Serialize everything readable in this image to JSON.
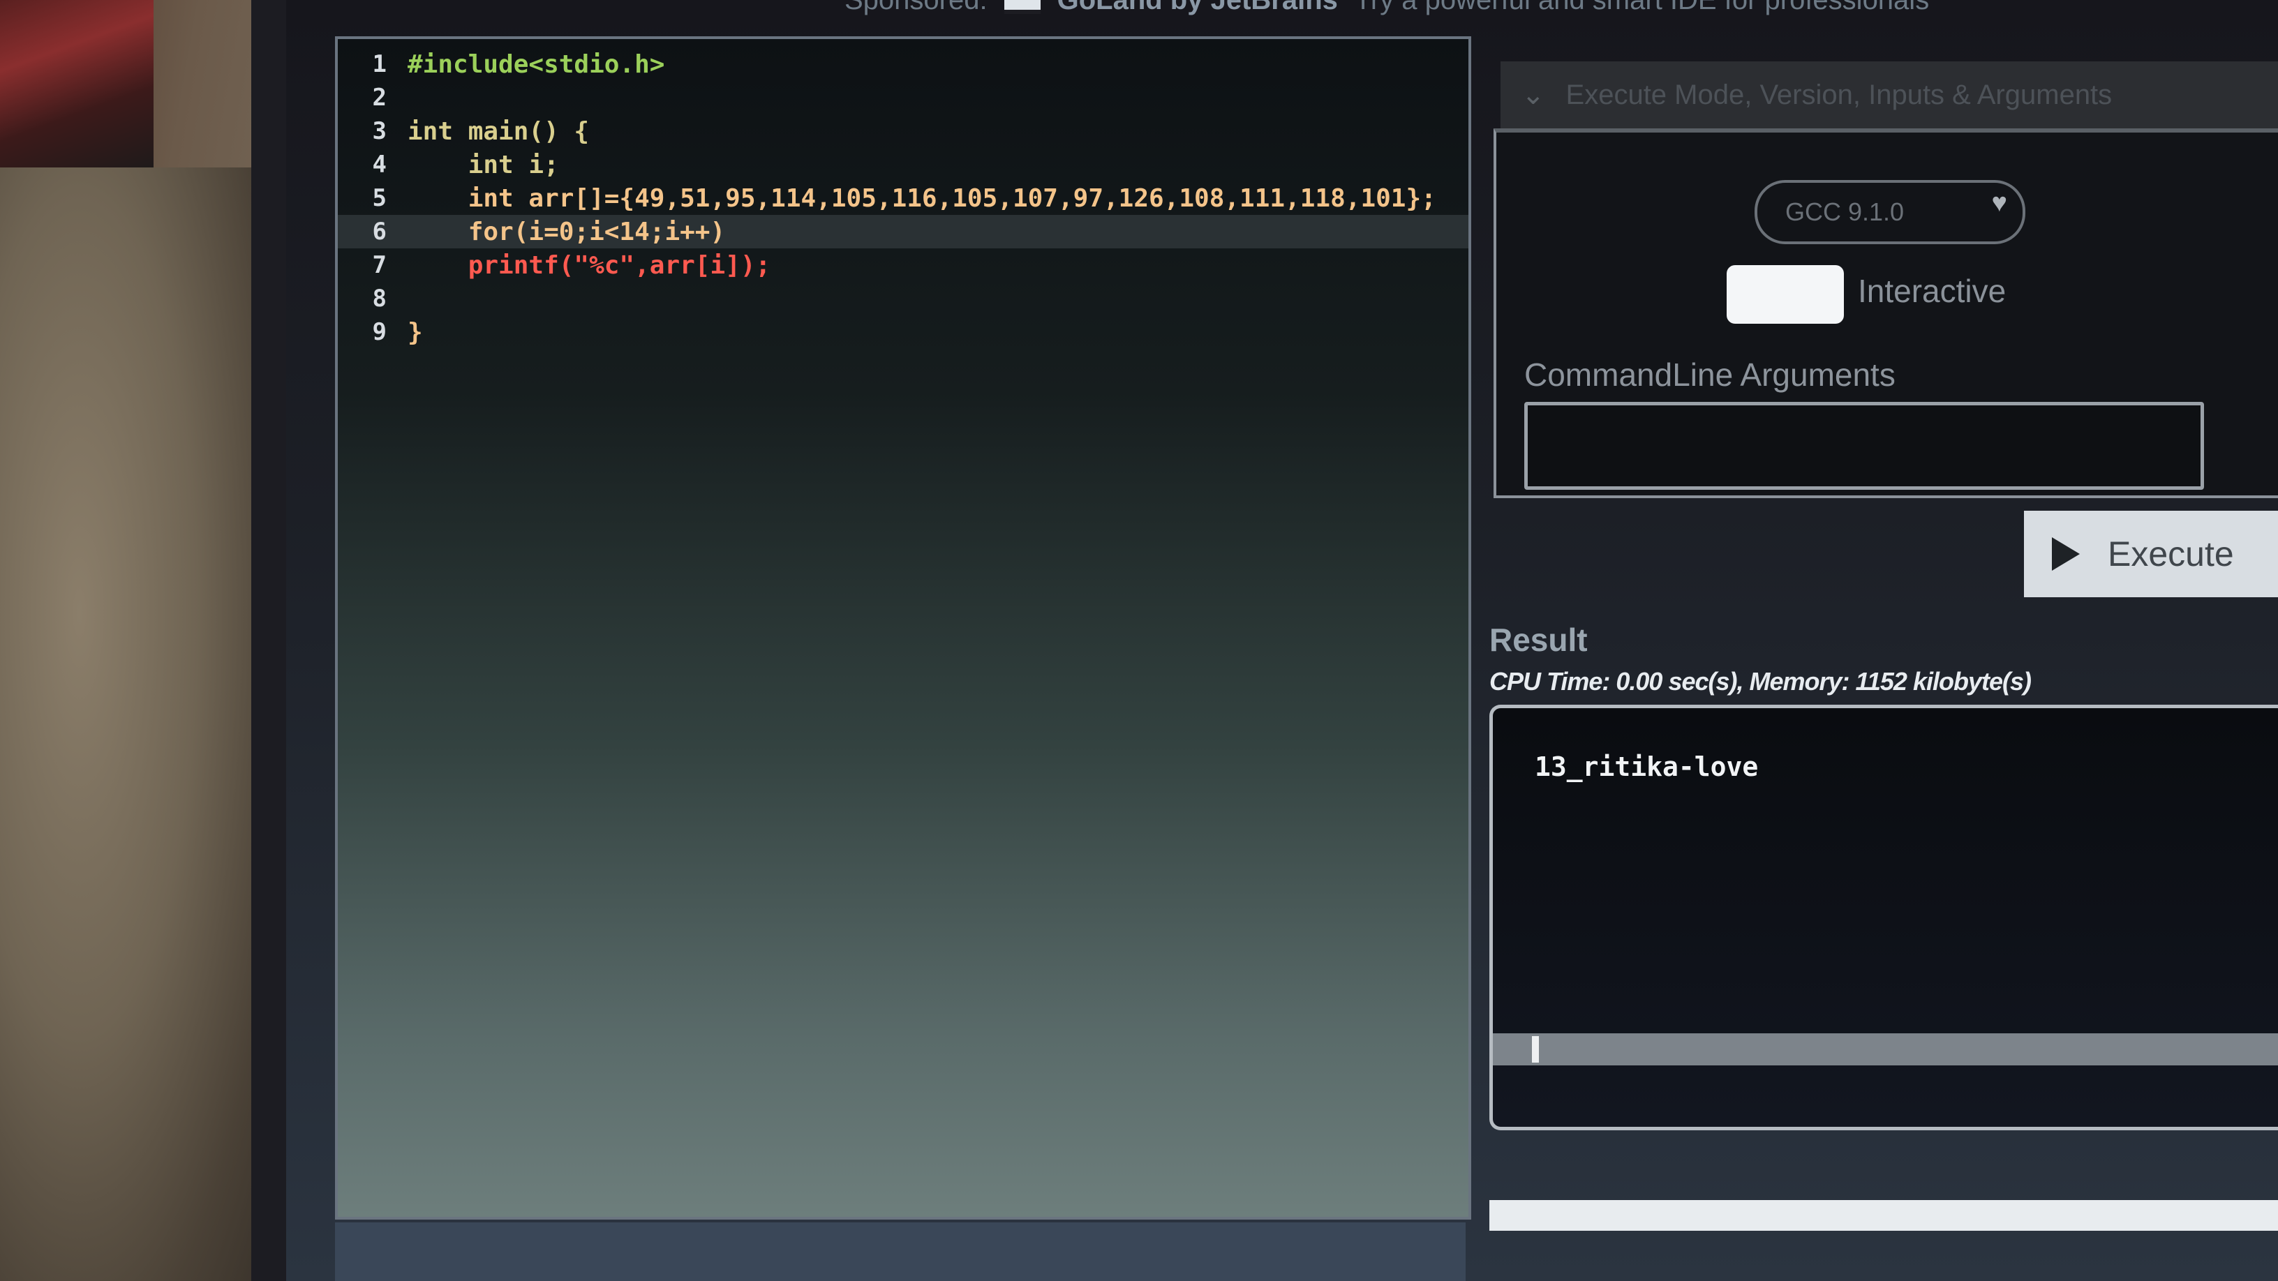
{
  "sponsor": {
    "label": "Sponsored:",
    "brand": "GoLand by JetBrains",
    "tagline": "Try a powerful and smart IDE for professionals"
  },
  "editor": {
    "lines": [
      {
        "num": "1",
        "text": "#include<stdio.h>"
      },
      {
        "num": "2",
        "text": ""
      },
      {
        "num": "3",
        "text": "int main() {"
      },
      {
        "num": "4",
        "text": "    int i;"
      },
      {
        "num": "5",
        "text": "    int arr[]={49,51,95,114,105,116,105,107,97,126,108,111,118,101};"
      },
      {
        "num": "6",
        "text": "    for(i=0;i<14;i++)"
      },
      {
        "num": "7",
        "text": "    printf(\"%c\",arr[i]);"
      },
      {
        "num": "8",
        "text": ""
      },
      {
        "num": "9",
        "text": "}"
      }
    ],
    "active_line": 6
  },
  "execute_mode": {
    "header": "Execute Mode, Version, Inputs & Arguments"
  },
  "options": {
    "compiler": "GCC 9.1.0",
    "interactive_label": "Interactive",
    "cli_label": "CommandLine Arguments",
    "cli_value": ""
  },
  "execute_button": "Execute",
  "result": {
    "title": "Result",
    "stats": "CPU Time: 0.00 sec(s), Memory: 1152 kilobyte(s)",
    "output": "13_ritika-love"
  },
  "colors": {
    "accent": "#d8dde2",
    "keyword": "#d9cf8e",
    "preprocessor": "#9bd05a",
    "function": "#e64a4a"
  }
}
